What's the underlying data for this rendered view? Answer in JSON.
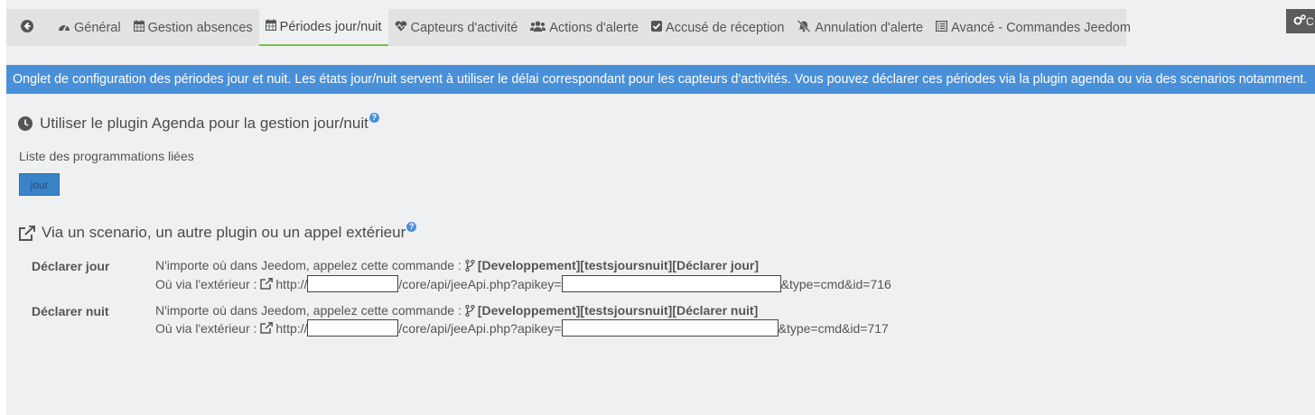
{
  "tabs": [
    {
      "label": "",
      "icon": "arrow-circle-left-icon"
    },
    {
      "label": "Général",
      "icon": "tachometer-icon"
    },
    {
      "label": "Gestion absences",
      "icon": "calendar-icon"
    },
    {
      "label": "Périodes jour/nuit",
      "icon": "calendar-icon",
      "active": true
    },
    {
      "label": "Capteurs d'activité",
      "icon": "heartbeat-icon"
    },
    {
      "label": "Actions d'alerte",
      "icon": "users-icon"
    },
    {
      "label": "Accusé de réception",
      "icon": "check-square-icon"
    },
    {
      "label": "Annulation d'alerte",
      "icon": "bell-slash-icon"
    },
    {
      "label": "Avancé - Commandes Jeedom",
      "icon": "list-alt-icon"
    }
  ],
  "top_right_button": {
    "label": "C",
    "icon": "cogs-icon"
  },
  "banner": {
    "text": "Onglet de configuration des périodes jour et nuit. Les états jour/nuit servent à utiliser le délai correspondant pour les capteurs d'activités. Vous pouvez déclarer ces périodes via la plugin agenda ou via des scenarios notamment."
  },
  "section_agenda": {
    "title": "Utiliser le plugin Agenda pour la gestion jour/nuit",
    "icon": "clock-icon",
    "help": "?",
    "list_label": "Liste des programmations liées",
    "programmations": [
      "jour"
    ]
  },
  "section_external": {
    "title": "Via un scenario, un autre plugin ou un appel extérieur",
    "icon": "external-link-icon",
    "help": "?",
    "rows": [
      {
        "label": "Déclarer jour",
        "command_prefix": "N'importe où dans Jeedom, appelez cette commande :",
        "command": "[Developpement][testsjoursnuit][Déclarer jour]",
        "url_prefix": "Où via l'extérieur :",
        "http": "http://",
        "path": "/core/api/jeeApi.php?apikey=",
        "suffix": "&type=cmd&id=716",
        "host_value": "",
        "apikey_value": ""
      },
      {
        "label": "Déclarer nuit",
        "command_prefix": "N'importe où dans Jeedom, appelez cette commande :",
        "command": "[Developpement][testsjoursnuit][Déclarer nuit]",
        "url_prefix": "Où via l'extérieur :",
        "http": "http://",
        "path": "/core/api/jeeApi.php?apikey=",
        "suffix": "&type=cmd&id=717",
        "host_value": "",
        "apikey_value": ""
      }
    ]
  }
}
